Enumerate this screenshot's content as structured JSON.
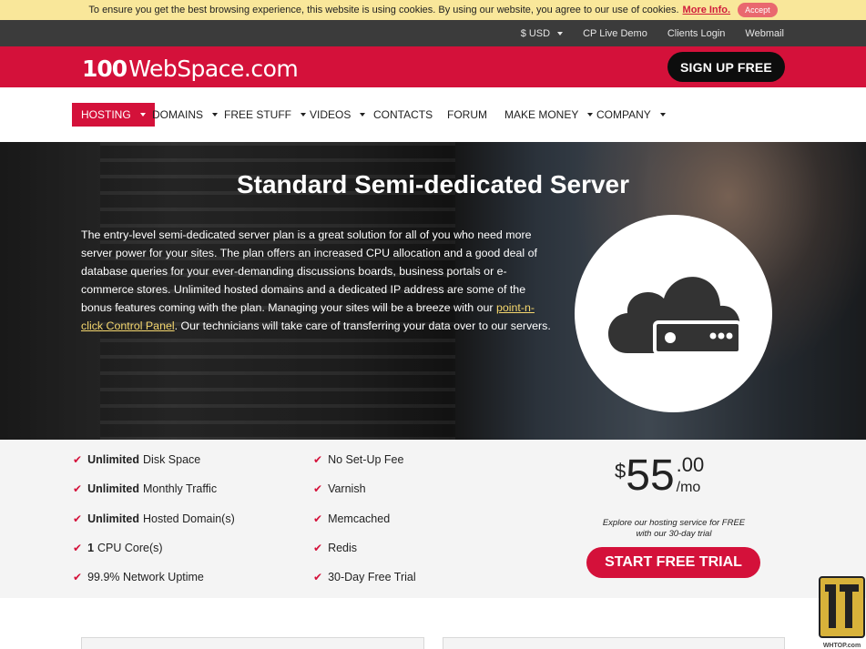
{
  "cookie": {
    "message": "To ensure you get the best browsing experience, this website is using cookies. By using our website, you agree to our use of cookies.",
    "more_info": "More Info.",
    "accept": "Accept"
  },
  "topbar": {
    "currency": "$ USD",
    "links": [
      "CP Live Demo",
      "Clients Login",
      "Webmail"
    ]
  },
  "header": {
    "logo_number": "100",
    "logo_text": "WebSpace.com",
    "signup": "SIGN UP FREE"
  },
  "nav": {
    "items": [
      {
        "label": "HOSTING"
      },
      {
        "label": "DOMAINS"
      },
      {
        "label": "FREE STUFF"
      },
      {
        "label": "VIDEOS"
      },
      {
        "label": "CONTACTS"
      },
      {
        "label": "FORUM"
      },
      {
        "label": "MAKE MONEY"
      },
      {
        "label": "COMPANY"
      }
    ]
  },
  "hero": {
    "title": "Standard Semi-dedicated Server",
    "desc_before": "The entry-level semi-dedicated server plan is a great solution for all of you who need more server power for your sites. The plan offers an increased CPU allocation and a good deal of database queries for your ever-demanding discussions boards, business portals or e-commerce stores. Unlimited hosted domains and a dedicated IP address are some of the bonus features coming with the plan. Managing your sites will be a breeze with our ",
    "desc_link": "point-n-click Control Panel",
    "desc_after": ". Our technicians will take care of transferring your data over to our servers.",
    "icon": "cloud-server-icon"
  },
  "features": {
    "left": [
      {
        "bold": "Unlimited",
        "text": "Disk Space"
      },
      {
        "bold": "Unlimited",
        "text": "Monthly Traffic"
      },
      {
        "bold": "Unlimited",
        "text": "Hosted Domain(s)"
      },
      {
        "bold": "1",
        "text": "CPU Core(s)"
      },
      {
        "bold": "",
        "text": "99.9% Network Uptime"
      }
    ],
    "right": [
      {
        "text": "No Set-Up Fee"
      },
      {
        "text": "Varnish"
      },
      {
        "text": "Memcached"
      },
      {
        "text": "Redis"
      },
      {
        "text": "30-Day Free Trial"
      }
    ]
  },
  "pricing": {
    "currency": "$",
    "whole": "55",
    "cents": ".00",
    "period": "/mo",
    "note_line1": "Explore our hosting service for FREE",
    "note_line2": "with our 30-day trial",
    "cta": "START FREE TRIAL"
  },
  "watermark": {
    "text": "WHTOP.com"
  },
  "colors": {
    "brand_red": "#d4113a",
    "cookie_bg": "#f9e79a",
    "topbar_bg": "#3b3b3b",
    "features_bg": "#f4f4f4"
  }
}
